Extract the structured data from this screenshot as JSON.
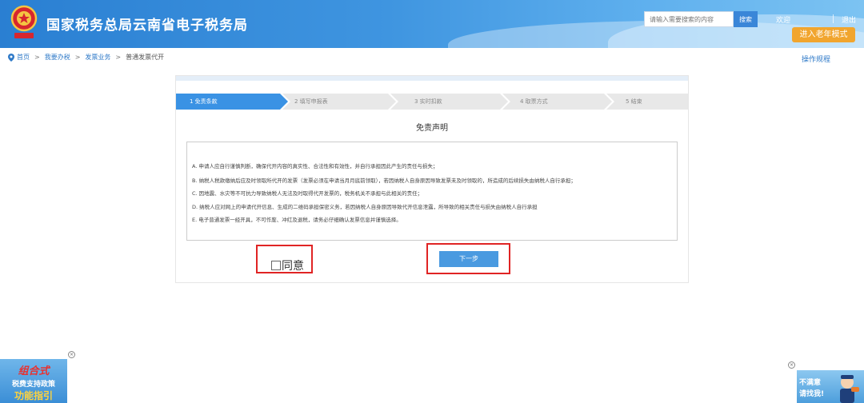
{
  "header": {
    "site_title": "国家税务总局云南省电子税务局",
    "search_placeholder": "请输入需要搜索的内容",
    "search_button": "搜索",
    "welcome": "欢迎",
    "logout": "退出",
    "elder_mode": "进入老年模式"
  },
  "breadcrumb": {
    "items": [
      "首页",
      "我要办税",
      "发票业务",
      "普通发票代开"
    ],
    "separator": ">"
  },
  "ops_link": "操作规程",
  "steps": [
    {
      "label": "1 免责条款",
      "active": true
    },
    {
      "label": "2 填写申报表",
      "active": false
    },
    {
      "label": "3 实时扣款",
      "active": false
    },
    {
      "label": "4 取票方式",
      "active": false
    },
    {
      "label": "5 结束",
      "active": false
    }
  ],
  "disclaimer": {
    "title": "免责声明",
    "terms": [
      "A. 申请人应自行谨慎判断，确保代开内容的真实性、合法性和有效性，并自行承担因此产生的责任与损失；",
      "B. 纳税人税款缴纳后应及时领取所代开的发票（发票必须在申请当月月底前领取），若因纳税人自身原因导致发票未及时领取的，所造成的后续损失由纳税人自行承担；",
      "C. 因地震、水灾等不可抗力导致纳税人无法及时取得代开发票的，税务机关不承担与此相关的责任；",
      "D. 纳税人应对网上的申请代开信息、生成的二维码承担保密义务，若因纳税人自身原因导致代开信息泄露，所导致的相关责任与损失由纳税人自行承担",
      "E. 电子普通发票一经开具，不可作废、冲红及退税，请务必仔细确认发票信息并谨慎选择。"
    ],
    "agree_label": "同意",
    "next_button": "下一步"
  },
  "float_left": {
    "line1": "组合式",
    "line2": "税费支持政策",
    "line3": "功能指引"
  },
  "float_right": {
    "line1": "不满意",
    "line2": "请找我!"
  },
  "colors": {
    "header_blue": "#2a7fd2",
    "active_step": "#3a92e4",
    "inactive_step": "#e8e8e8",
    "elder_button": "#f1a52e",
    "highlight_red": "#e02424"
  }
}
